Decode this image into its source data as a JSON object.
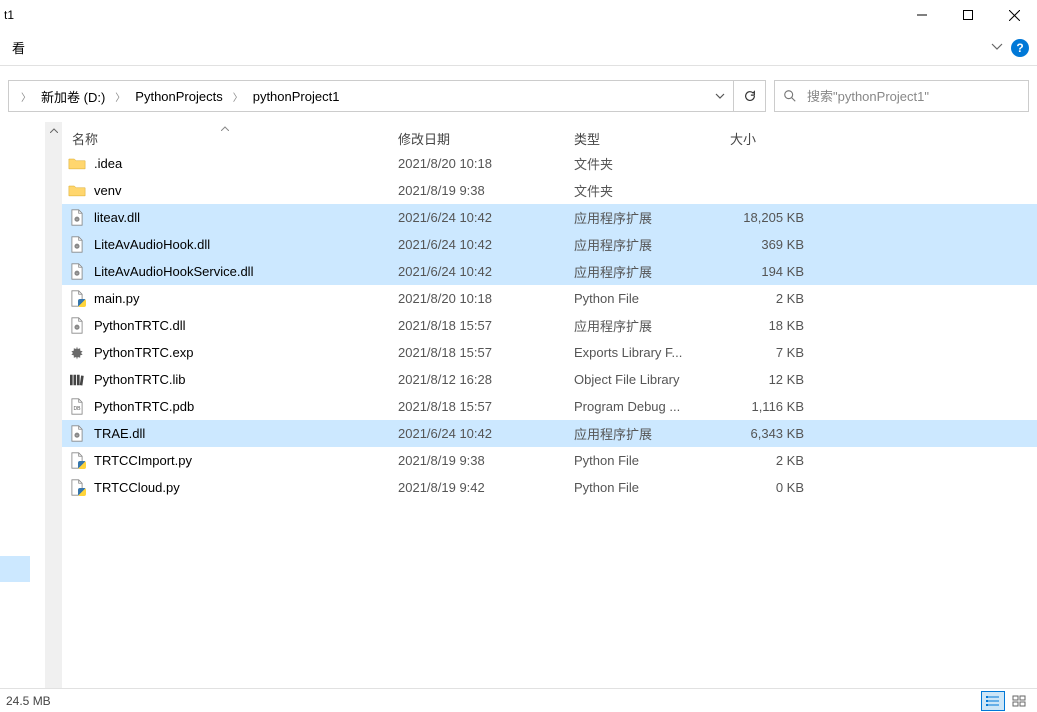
{
  "window": {
    "title": "t1"
  },
  "ribbon": {
    "visible_tab": "看"
  },
  "breadcrumb": {
    "items": [
      "新加卷 (D:)",
      "PythonProjects",
      "pythonProject1"
    ]
  },
  "search": {
    "placeholder": "搜索\"pythonProject1\""
  },
  "columns": {
    "name": "名称",
    "date": "修改日期",
    "type": "类型",
    "size": "大小"
  },
  "files": [
    {
      "icon": "folder",
      "name": ".idea",
      "date": "2021/8/20 10:18",
      "type": "文件夹",
      "size": "",
      "selected": false
    },
    {
      "icon": "folder",
      "name": "venv",
      "date": "2021/8/19 9:38",
      "type": "文件夹",
      "size": "",
      "selected": false
    },
    {
      "icon": "dll",
      "name": "liteav.dll",
      "date": "2021/6/24 10:42",
      "type": "应用程序扩展",
      "size": "18,205 KB",
      "selected": true
    },
    {
      "icon": "dll",
      "name": "LiteAvAudioHook.dll",
      "date": "2021/6/24 10:42",
      "type": "应用程序扩展",
      "size": "369 KB",
      "selected": true
    },
    {
      "icon": "dll",
      "name": "LiteAvAudioHookService.dll",
      "date": "2021/6/24 10:42",
      "type": "应用程序扩展",
      "size": "194 KB",
      "selected": true
    },
    {
      "icon": "py",
      "name": "main.py",
      "date": "2021/8/20 10:18",
      "type": "Python File",
      "size": "2 KB",
      "selected": false
    },
    {
      "icon": "dll",
      "name": "PythonTRTC.dll",
      "date": "2021/8/18 15:57",
      "type": "应用程序扩展",
      "size": "18 KB",
      "selected": false
    },
    {
      "icon": "gear",
      "name": "PythonTRTC.exp",
      "date": "2021/8/18 15:57",
      "type": "Exports Library F...",
      "size": "7 KB",
      "selected": false
    },
    {
      "icon": "lib",
      "name": "PythonTRTC.lib",
      "date": "2021/8/12 16:28",
      "type": "Object File Library",
      "size": "12 KB",
      "selected": false
    },
    {
      "icon": "pdb",
      "name": "PythonTRTC.pdb",
      "date": "2021/8/18 15:57",
      "type": "Program Debug ...",
      "size": "1,116 KB",
      "selected": false
    },
    {
      "icon": "dll",
      "name": "TRAE.dll",
      "date": "2021/6/24 10:42",
      "type": "应用程序扩展",
      "size": "6,343 KB",
      "selected": true
    },
    {
      "icon": "py",
      "name": "TRTCCImport.py",
      "date": "2021/8/19 9:38",
      "type": "Python File",
      "size": "2 KB",
      "selected": false
    },
    {
      "icon": "py",
      "name": "TRTCCloud.py",
      "date": "2021/8/19 9:42",
      "type": "Python File",
      "size": "0 KB",
      "selected": false
    }
  ],
  "status": {
    "selection_size": "24.5 MB"
  }
}
